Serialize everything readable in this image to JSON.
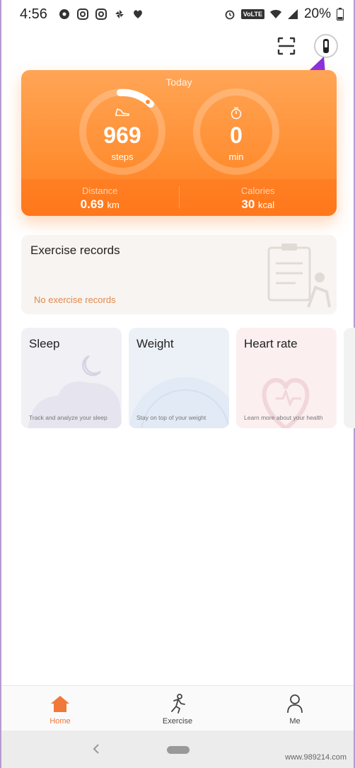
{
  "status_bar": {
    "time": "4:56",
    "network": "VoLTE",
    "battery": "20%"
  },
  "top_actions": {
    "scan_icon": "scan-icon",
    "band_icon": "band-device-icon"
  },
  "today": {
    "label": "Today",
    "steps_value": "969",
    "steps_unit": "steps",
    "minutes_value": "0",
    "minutes_unit": "min",
    "distance_label": "Distance",
    "distance_value": "0.69",
    "distance_unit": "km",
    "calories_label": "Calories",
    "calories_value": "30",
    "calories_unit": "kcal",
    "accent": "#ff8f33"
  },
  "exercise": {
    "title": "Exercise records",
    "empty_text": "No exercise records"
  },
  "tiles": [
    {
      "title": "Sleep",
      "desc": "Track and analyze your sleep"
    },
    {
      "title": "Weight",
      "desc": "Stay on top of your weight"
    },
    {
      "title": "Heart rate",
      "desc": "Learn more about your health"
    }
  ],
  "bottom_nav": {
    "items": [
      {
        "label": "Home",
        "icon": "home-icon"
      },
      {
        "label": "Exercise",
        "icon": "runner-icon"
      },
      {
        "label": "Me",
        "icon": "person-icon"
      }
    ],
    "active_color": "#f07838"
  },
  "watermark": "www.989214.com"
}
